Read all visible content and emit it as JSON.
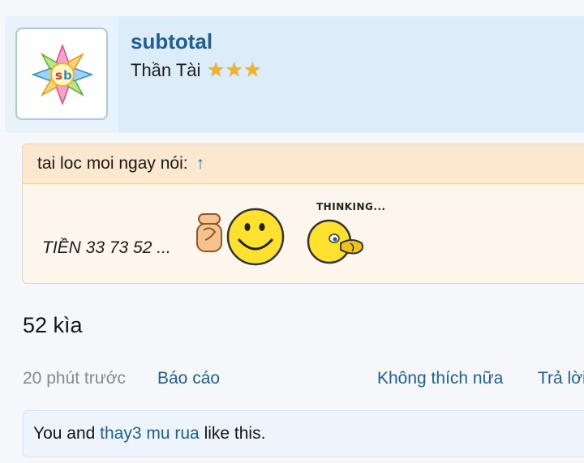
{
  "user": {
    "username": "subtotal",
    "title": "Thần Tài",
    "star_count": 3,
    "avatar_icon": "sb-flower-logo-icon"
  },
  "quote": {
    "author_label": "tai loc moi ngay nói:",
    "arrow": "↑",
    "text": "TIỀN 33 73 52 ...",
    "thinking_label": "THINKING...",
    "emoticons": [
      "pointing-smiley-icon",
      "thinking-smiley-icon"
    ]
  },
  "post": {
    "message": "52 kìa"
  },
  "footer": {
    "time": "20 phút trước",
    "report": "Báo cáo",
    "unlike": "Không thích nữa",
    "reply": "Trả lời"
  },
  "likes": {
    "prefix": "You and",
    "user_link": "thay3 mu rua",
    "suffix": "like this."
  },
  "colors": {
    "link": "#1f5f96",
    "quote_border": "#f2cf9c",
    "header_bg": "#dcecf8"
  }
}
